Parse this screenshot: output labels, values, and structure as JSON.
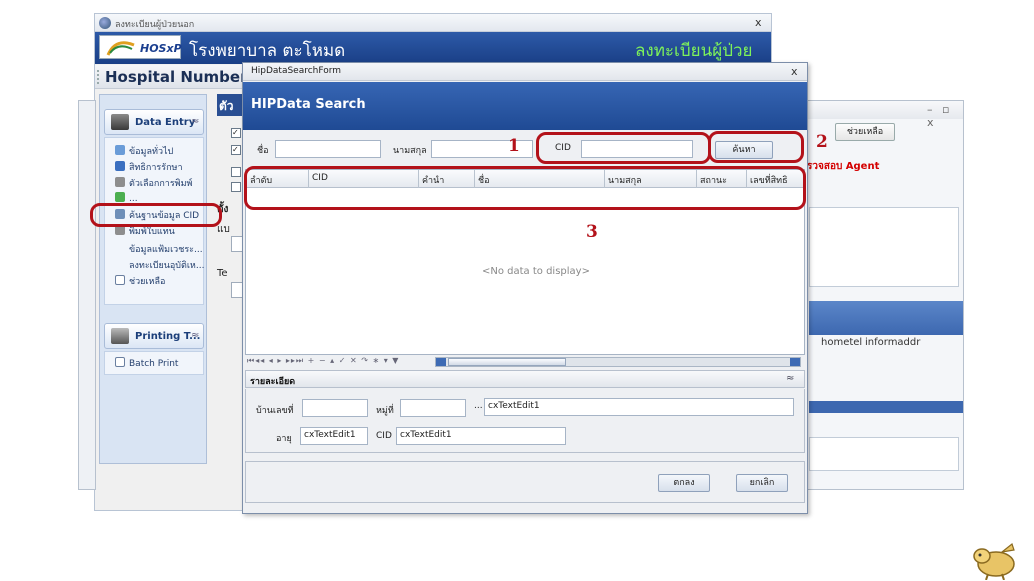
{
  "outer_window": {
    "title": "ลงทะเบียนผู้ป่วยนอก",
    "close_symbol": "x",
    "hospital_name": "โรงพยาบาล ตะโหมด",
    "register_title": "ลงทะเบียนผู้ป่วย",
    "logo_text": "HOSxP",
    "hospital_number_label": "Hospital Number",
    "behind_label": "ตัว"
  },
  "left_nav": {
    "group1_title": "Data Entry",
    "group1_items": [
      "ข้อมูลทั่วไป",
      "สิทธิการรักษา",
      "ตัวเลือกการพิมพ์",
      "...",
      "ค้นฐานข้อมูล CID",
      "พิมพ์ใบแทน",
      "ข้อมูลแฟ้มเวชระ...",
      "ลงทะเบียนอุบัติเห...",
      "ช่วยเหลือ"
    ],
    "group2_title": "Printing T...",
    "group2_items": [
      "Batch Print"
    ]
  },
  "background_window": {
    "help_button": "ช่วยเหลือ",
    "agent_text": "รวจสอบ Agent",
    "col_hometel": "hometel",
    "col_informaddr": "informaddr",
    "behind_labels": [
      "ตั้ง",
      "แบ",
      "Te"
    ]
  },
  "dialog": {
    "window_title": "HipDataSearchForm",
    "close_symbol": "x",
    "header": "HIPData Search",
    "search": {
      "first_name_label": "ชื่อ",
      "first_name_value": "",
      "last_name_label": "นามสกุล",
      "last_name_value": "",
      "cid_label": "CID",
      "cid_value": "",
      "search_button": "ค้นหา"
    },
    "grid": {
      "columns": [
        "ลำดับ",
        "CID",
        "คำนำ",
        "ชื่อ",
        "นามสกุล",
        "สถานะ",
        "เลขที่สิทธิ"
      ],
      "empty_text": "<No data to display>"
    },
    "nav_buttons": "⏮◂◂ ◂ ▸ ▸▸⏭ + − ▴ ✓ ✕ ↷ ∗ ▾ ▼",
    "details": {
      "title": "รายละเอียด",
      "house_no_label": "บ้านเลขที่",
      "house_no_value": "",
      "moo_label": "หมู่ที่",
      "moo_value": "",
      "address_value": "cxTextEdit1",
      "age_label": "อายุ",
      "age_value": "cxTextEdit1",
      "cid_label": "CID",
      "cid_value": "cxTextEdit1",
      "ellipsis": "..."
    },
    "ok_button": "ตกลง",
    "cancel_button": "ยกเลิก"
  },
  "annotations": {
    "num1": "1",
    "num2": "2",
    "num3": "3"
  },
  "colors": {
    "accent_blue": "#1f4a94",
    "annotation_red": "#b3121a",
    "banner_green_text": "#7ef25a"
  }
}
